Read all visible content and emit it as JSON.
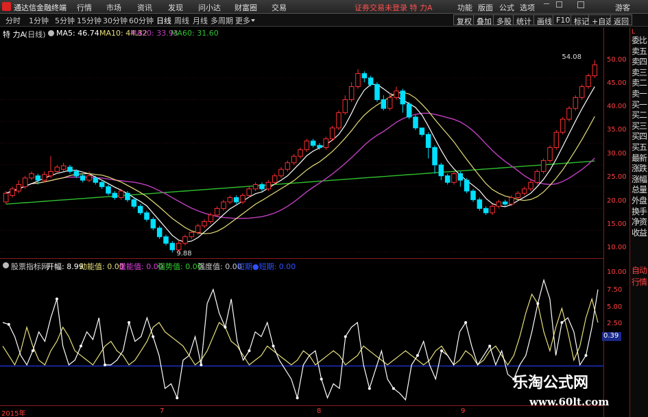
{
  "titlebar": {
    "app_name": "通达信金融终端",
    "menus": [
      "行情",
      "市场",
      "资讯",
      "发现",
      "问小达",
      "财富圈",
      "交易"
    ],
    "status": "证券交易未登录  特 力A",
    "right_menus": [
      "功能",
      "版面",
      "公式",
      "选项"
    ],
    "guest": "游客"
  },
  "toolbar": {
    "periods": [
      "分时",
      "1分钟",
      "5分钟",
      "15分钟",
      "30分钟",
      "60分钟",
      "日线",
      "周线",
      "月线",
      "多周期",
      "更多"
    ],
    "active_period": "日线",
    "right_buttons": [
      "复权",
      "叠加",
      "多股",
      "统计",
      "画线",
      "F10",
      "标记",
      "+自选",
      "返回"
    ]
  },
  "info": {
    "stock": "特 力A",
    "period_tag": "(日线)",
    "ma5": "MA5: 46.74",
    "ma10": "MA10: 44.32",
    "ma20": "MA20: 33.93",
    "ma60": "MA60: 31.60"
  },
  "colors": {
    "ma5": "#ffffff",
    "ma10": "#e8e07a",
    "ma20": "#c040c0",
    "ma60": "#30c030",
    "up": "#ff3030",
    "down": "#00e0ff",
    "axis": "#ff4040"
  },
  "side_panel": [
    "委比",
    "卖五",
    "卖四",
    "卖三",
    "卖二",
    "卖一",
    "买一",
    "买二",
    "买三",
    "买四",
    "买五",
    "最新",
    "涨跌",
    "涨幅",
    "总量",
    "外盘",
    "换手",
    "净资",
    "收益",
    "自动",
    "行情"
  ],
  "indicator": {
    "name": "股票指标网",
    "kaifu": "开幅: 8.99",
    "dongneng": "动能值: 0.00",
    "liangneng": "量能值: 0.00",
    "qiangshi": "强势值: 0.00",
    "qiangdu": "强度值: 0.00",
    "extra": "短期●短期: 0.00",
    "current_value": "0.39"
  },
  "chart_data": {
    "type": "candlestick",
    "price_axis_ticks": [
      "50.00",
      "45.00",
      "40.00",
      "35.00",
      "30.00",
      "25.00",
      "20.00",
      "15.00",
      "10.00"
    ],
    "indicator_axis_ticks": [
      "10.00",
      "7.50",
      "5.00",
      "2.50",
      "0.00"
    ],
    "x_labels": [
      "2015年",
      "7",
      "8",
      "9"
    ],
    "high_annotation": "54.08",
    "low_annotation": "9.88",
    "candles": [
      [
        21.5,
        23.5,
        21,
        24
      ],
      [
        23,
        24.5,
        22.5,
        25
      ],
      [
        24,
        25.5,
        23.5,
        26.5
      ],
      [
        25,
        27,
        24.5,
        27.5
      ],
      [
        27,
        28,
        26.5,
        28.5
      ],
      [
        27.5,
        26.5,
        25.5,
        28
      ],
      [
        26.5,
        27.8,
        26,
        28.5
      ],
      [
        27.5,
        28.5,
        27,
        32
      ],
      [
        28.5,
        29.5,
        28,
        30
      ],
      [
        29,
        29.8,
        28.5,
        30.5
      ],
      [
        29.5,
        28.5,
        28,
        30
      ],
      [
        28.5,
        27.5,
        27,
        29
      ],
      [
        27.5,
        26.5,
        26,
        28
      ],
      [
        26.5,
        27.5,
        26,
        28.5
      ],
      [
        27,
        26,
        25.5,
        27.5
      ],
      [
        26,
        25,
        24.5,
        26.5
      ],
      [
        25,
        23.5,
        23,
        25.5
      ],
      [
        23.5,
        22.5,
        22,
        24
      ],
      [
        22.5,
        24,
        22,
        24.5
      ],
      [
        23.5,
        22,
        21.5,
        24
      ],
      [
        22,
        20.5,
        20,
        22.5
      ],
      [
        20.5,
        19,
        18.5,
        21
      ],
      [
        19,
        17.5,
        17,
        19.5
      ],
      [
        17.5,
        15.5,
        15,
        18
      ],
      [
        15.5,
        13.5,
        13,
        16
      ],
      [
        13.5,
        12,
        11.5,
        14
      ],
      [
        12,
        10.5,
        9.88,
        12.5
      ],
      [
        10.5,
        12,
        10,
        12.5
      ],
      [
        12,
        13.5,
        11.5,
        14
      ],
      [
        13.5,
        14.5,
        13,
        15
      ],
      [
        14.5,
        16,
        14,
        16.5
      ],
      [
        16,
        17,
        15.5,
        17.5
      ],
      [
        17,
        18.5,
        16.5,
        19
      ],
      [
        18.5,
        20,
        18,
        20.5
      ],
      [
        20,
        21.5,
        19.5,
        22
      ],
      [
        21.5,
        22.5,
        21,
        23
      ],
      [
        22.5,
        21.5,
        21,
        23
      ],
      [
        21.5,
        23,
        21,
        23.5
      ],
      [
        23,
        24.5,
        22.5,
        25
      ],
      [
        24.5,
        25.5,
        24,
        26
      ],
      [
        25.5,
        24.5,
        24,
        26
      ],
      [
        24.5,
        26,
        24,
        26.5
      ],
      [
        26,
        27.5,
        25.5,
        28
      ],
      [
        27.5,
        29,
        27,
        29.5
      ],
      [
        29,
        30.5,
        28.5,
        31
      ],
      [
        30.5,
        32,
        30,
        32.5
      ],
      [
        32,
        33.5,
        31.5,
        34
      ],
      [
        33.5,
        35.5,
        33,
        36
      ],
      [
        35.5,
        34.5,
        34,
        36
      ],
      [
        34.5,
        34,
        33.5,
        35
      ],
      [
        34,
        36,
        33.5,
        36.5
      ],
      [
        36,
        38.5,
        35.5,
        39
      ],
      [
        38.5,
        42,
        38,
        42.5
      ],
      [
        42,
        45,
        41.5,
        46
      ],
      [
        45,
        48,
        44.5,
        49
      ],
      [
        48,
        51,
        47.5,
        52
      ],
      [
        51,
        50,
        49,
        51.5
      ],
      [
        50,
        48.5,
        48,
        50.5
      ],
      [
        48.5,
        45,
        44.5,
        49
      ],
      [
        45,
        43,
        42.5,
        46
      ],
      [
        43,
        45.5,
        42.5,
        46.5
      ],
      [
        45.5,
        47,
        45,
        48
      ],
      [
        47,
        44,
        42,
        47.5
      ],
      [
        44,
        41,
        40.5,
        44.5
      ],
      [
        41,
        38.5,
        38,
        41.5
      ],
      [
        38.5,
        37,
        36.5,
        38.5
      ],
      [
        37,
        34,
        31.5,
        37.5
      ],
      [
        34,
        30,
        28,
        34.5
      ],
      [
        30,
        27.5,
        26.5,
        30.5
      ],
      [
        27.5,
        26,
        25.5,
        28
      ],
      [
        26,
        28,
        25.5,
        28.5
      ],
      [
        28,
        26.5,
        25,
        28.5
      ],
      [
        26.5,
        24,
        23.5,
        27
      ],
      [
        24,
        22,
        21.5,
        24.5
      ],
      [
        22,
        20,
        19.5,
        22.5
      ],
      [
        20,
        19,
        18.5,
        20.5
      ],
      [
        19,
        20.5,
        18.5,
        21
      ],
      [
        20.5,
        21.5,
        20,
        22
      ],
      [
        21.5,
        21,
        20.5,
        22
      ],
      [
        21,
        22.5,
        20.5,
        23
      ],
      [
        22.5,
        23.5,
        22,
        24
      ],
      [
        23.5,
        24.5,
        23,
        25
      ],
      [
        24.5,
        26,
        24,
        26.5
      ],
      [
        26,
        28.5,
        25.5,
        29
      ],
      [
        28.5,
        31,
        28,
        31.5
      ],
      [
        31,
        34,
        30.5,
        34.5
      ],
      [
        34,
        37.5,
        33.5,
        38
      ],
      [
        37.5,
        40.5,
        37,
        41
      ],
      [
        40.5,
        43,
        40,
        43.5
      ],
      [
        43,
        45.5,
        42.5,
        46
      ],
      [
        45.5,
        48,
        45,
        48.5
      ],
      [
        48,
        50.5,
        47.5,
        51
      ],
      [
        50.5,
        53,
        50,
        54.08
      ]
    ],
    "indicator_series": {
      "white": [
        5,
        4.8,
        3.5,
        1.5,
        0.5,
        2,
        4,
        3,
        5.5,
        7.5,
        2.5,
        0.5,
        1,
        2.5,
        4,
        3.2,
        5.5,
        0.5,
        0.5,
        1,
        2,
        5,
        3,
        3.5,
        5.5,
        3.5,
        1.5,
        -2,
        -1.5,
        -3,
        1,
        1.5,
        3.5,
        0.5,
        7,
        8.5,
        6,
        4.5,
        7.5,
        3,
        1,
        2,
        4,
        3.5,
        5,
        2.5,
        1,
        0,
        -1,
        -3,
        0.5,
        1.5,
        2,
        -1,
        -3,
        -1.5,
        -2,
        3.5,
        4.5,
        5,
        0.5,
        -2,
        0,
        2,
        -1,
        -2,
        -2.5,
        -3.2,
        0.5,
        1.5,
        3,
        0.5,
        -1,
        2,
        1.5,
        0.5,
        4,
        5,
        2.5,
        0.5,
        1.5,
        2.5,
        0.5,
        2,
        -0.5,
        -1,
        0.5,
        1.5,
        4,
        7,
        9.5,
        7.5,
        1.5,
        5,
        5.5,
        4,
        0.5,
        1.5,
        4.5,
        8.5
      ],
      "yellow": [
        2.5,
        1.5,
        0.5,
        2,
        4.5,
        2.5,
        1,
        0.5,
        2,
        3,
        4.5,
        3.5,
        2,
        1.5,
        1,
        0.5,
        1.5,
        2.5,
        3,
        2,
        1.5,
        0.5,
        1,
        2,
        3,
        4.5,
        5,
        4,
        3.5,
        3,
        2.5,
        1.5,
        0.5,
        1,
        2,
        3.5,
        5,
        4.5,
        3,
        2.5,
        1.5,
        0.5,
        1,
        1.5,
        2.5,
        2,
        1.5,
        1,
        0.5,
        1,
        2,
        1.5,
        0.5,
        1,
        1.5,
        2,
        1.5,
        0.5,
        1,
        1.5,
        2.5,
        2,
        1.5,
        1,
        0.5,
        1,
        1.5,
        2,
        1.5,
        1,
        0.5,
        1,
        2,
        2.5,
        1.5,
        0.5,
        1,
        2,
        1.5,
        0.5,
        1,
        2,
        2.5,
        1.5,
        0.5,
        1.5,
        3.5,
        6,
        8,
        7,
        4,
        2,
        4.5,
        6.5,
        4,
        1,
        2.5,
        5.5,
        7.5,
        5
      ]
    }
  },
  "watermark": {
    "title": "乐淘公式网",
    "url": "www.60lt.com"
  }
}
